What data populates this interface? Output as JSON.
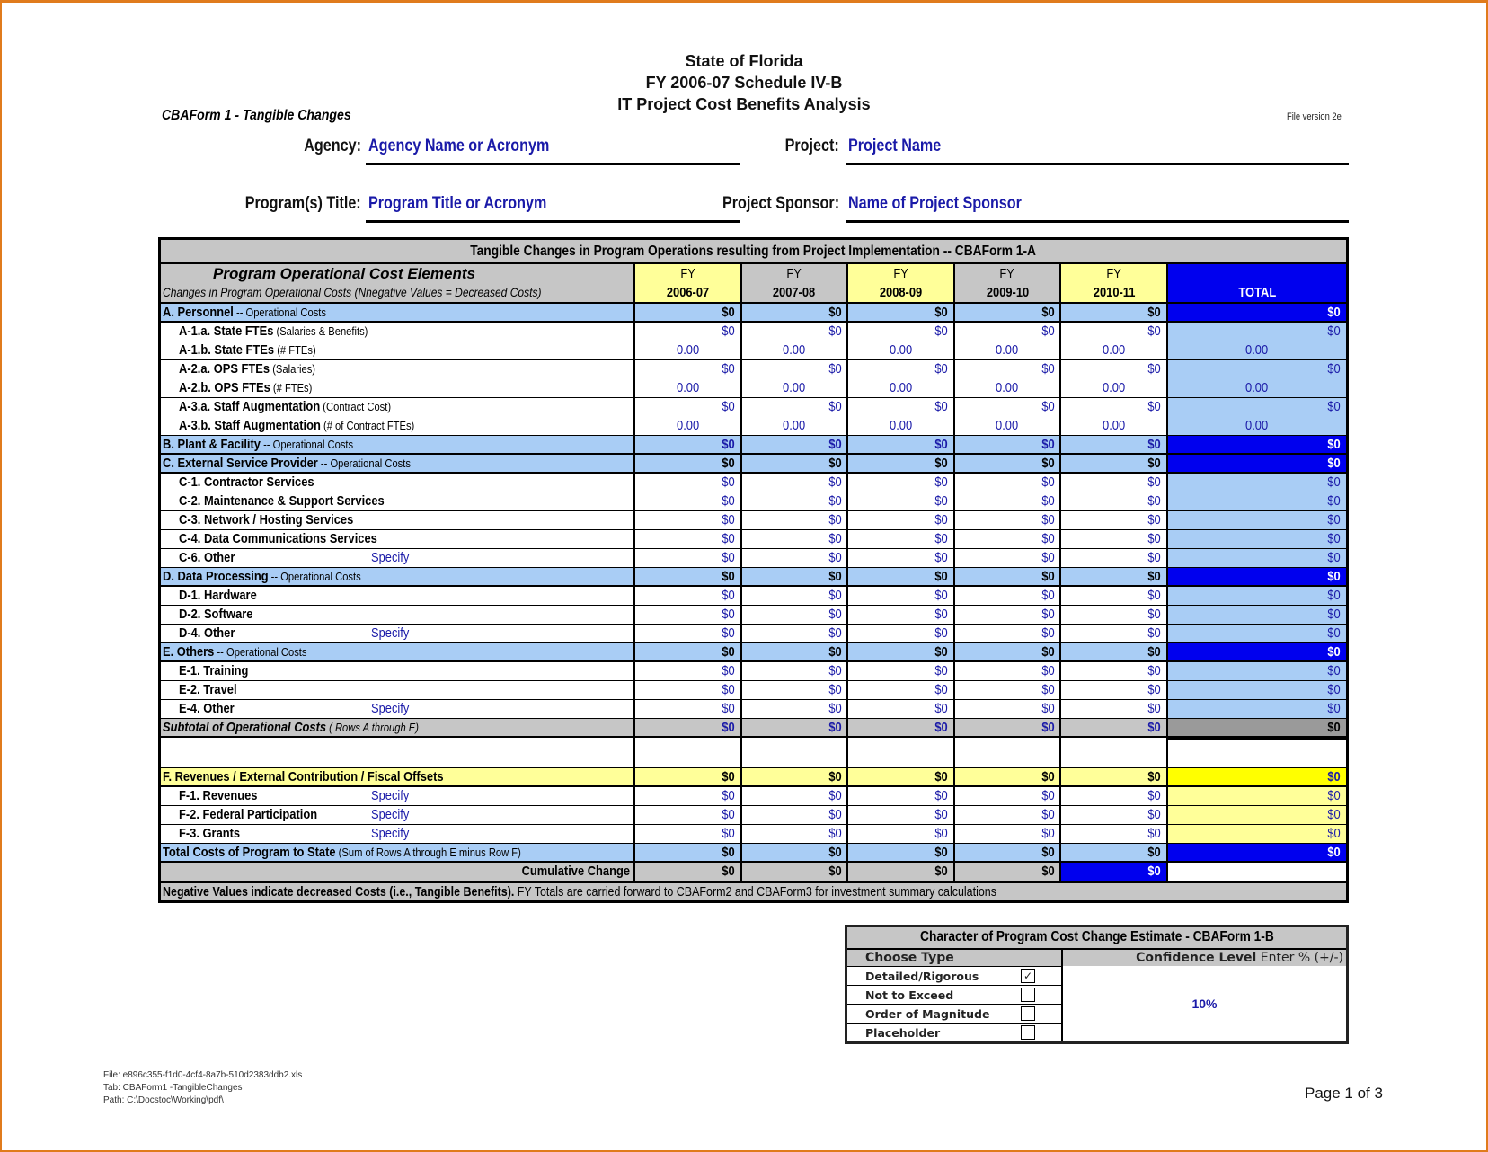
{
  "header": {
    "title_lines": [
      "State of Florida",
      "FY 2006-07 Schedule IV-B",
      "IT Project Cost Benefits Analysis"
    ],
    "form_name": "CBAForm 1 - Tangible Changes",
    "file_version": "File version 2e",
    "fields": {
      "agency_label": "Agency:",
      "agency_value": "Agency Name or Acronym",
      "project_label": "Project:",
      "project_value": "Project Name",
      "program_label": "Program(s) Title:",
      "program_value": "Program Title or Acronym",
      "sponsor_label": "Project Sponsor:",
      "sponsor_value": "Name of Project Sponsor"
    }
  },
  "table": {
    "title": "Tangible Changes in Program Operations resulting from Project  Implementation  -- CBAForm 1-A",
    "elements_header": "Program Operational Cost Elements",
    "elements_subheader": "Changes in Program Operational Costs (Nnegative Values = Decreased Costs)",
    "fy_prefix": "FY",
    "fiscal_years": [
      "2006-07",
      "2007-08",
      "2008-09",
      "2009-10",
      "2010-11"
    ],
    "total_label": "TOTAL",
    "rows": {
      "a": {
        "label": "A. Personnel",
        "suffix": " -- Operational Costs",
        "values": [
          "$0",
          "$0",
          "$0",
          "$0",
          "$0"
        ],
        "total": "$0"
      },
      "a1a": {
        "label": "A-1.a.  State FTEs",
        "suffix": " (Salaries & Benefits)",
        "values": [
          "$0",
          "$0",
          "$0",
          "$0",
          "$0"
        ],
        "total": "$0"
      },
      "a1b": {
        "label": "A-1.b.  State FTEs",
        "suffix": " (# FTEs)",
        "values": [
          "0.00",
          "0.00",
          "0.00",
          "0.00",
          "0.00"
        ],
        "total": "0.00"
      },
      "a2a": {
        "label": "A-2.a.  OPS FTEs",
        "suffix": " (Salaries)",
        "values": [
          "$0",
          "$0",
          "$0",
          "$0",
          "$0"
        ],
        "total": "$0"
      },
      "a2b": {
        "label": "A-2.b.  OPS FTEs",
        "suffix": " (# FTEs)",
        "values": [
          "0.00",
          "0.00",
          "0.00",
          "0.00",
          "0.00"
        ],
        "total": "0.00"
      },
      "a3a": {
        "label": "A-3.a.  Staff Augmentation",
        "suffix": " (Contract Cost)",
        "values": [
          "$0",
          "$0",
          "$0",
          "$0",
          "$0"
        ],
        "total": "$0"
      },
      "a3b": {
        "label": "A-3.b.  Staff Augmentation",
        "suffix": " (# of Contract FTEs)",
        "values": [
          "0.00",
          "0.00",
          "0.00",
          "0.00",
          "0.00"
        ],
        "total": "0.00"
      },
      "b": {
        "label": "B. Plant & Facility",
        "suffix": " -- Operational Costs",
        "values": [
          "$0",
          "$0",
          "$0",
          "$0",
          "$0"
        ],
        "total": "$0"
      },
      "c": {
        "label": "C. External Service Provider",
        "suffix": " -- Operational Costs",
        "values": [
          "$0",
          "$0",
          "$0",
          "$0",
          "$0"
        ],
        "total": "$0"
      },
      "c1": {
        "label": "C-1. Contractor Services",
        "values": [
          "$0",
          "$0",
          "$0",
          "$0",
          "$0"
        ],
        "total": "$0"
      },
      "c2": {
        "label": "C-2. Maintenance & Support Services",
        "values": [
          "$0",
          "$0",
          "$0",
          "$0",
          "$0"
        ],
        "total": "$0"
      },
      "c3": {
        "label": "C-3. Network / Hosting Services",
        "values": [
          "$0",
          "$0",
          "$0",
          "$0",
          "$0"
        ],
        "total": "$0"
      },
      "c4": {
        "label": "C-4. Data Communications Services",
        "values": [
          "$0",
          "$0",
          "$0",
          "$0",
          "$0"
        ],
        "total": "$0"
      },
      "c6": {
        "label": "C-6. Other",
        "specify": "Specify",
        "values": [
          "$0",
          "$0",
          "$0",
          "$0",
          "$0"
        ],
        "total": "$0"
      },
      "d": {
        "label": "D. Data Processing",
        "suffix": " -- Operational Costs",
        "values": [
          "$0",
          "$0",
          "$0",
          "$0",
          "$0"
        ],
        "total": "$0"
      },
      "d1": {
        "label": "D-1. Hardware",
        "values": [
          "$0",
          "$0",
          "$0",
          "$0",
          "$0"
        ],
        "total": "$0"
      },
      "d2": {
        "label": "D-2. Software",
        "values": [
          "$0",
          "$0",
          "$0",
          "$0",
          "$0"
        ],
        "total": "$0"
      },
      "d4": {
        "label": "D-4. Other",
        "specify": "Specify",
        "values": [
          "$0",
          "$0",
          "$0",
          "$0",
          "$0"
        ],
        "total": "$0"
      },
      "e": {
        "label": "E. Others",
        "suffix": " -- Operational Costs",
        "values": [
          "$0",
          "$0",
          "$0",
          "$0",
          "$0"
        ],
        "total": "$0"
      },
      "e1": {
        "label": "E-1. Training",
        "values": [
          "$0",
          "$0",
          "$0",
          "$0",
          "$0"
        ],
        "total": "$0"
      },
      "e2": {
        "label": "E-2. Travel",
        "values": [
          "$0",
          "$0",
          "$0",
          "$0",
          "$0"
        ],
        "total": "$0"
      },
      "e4": {
        "label": "E-4. Other",
        "specify": "Specify",
        "values": [
          "$0",
          "$0",
          "$0",
          "$0",
          "$0"
        ],
        "total": "$0"
      },
      "sub": {
        "label": "Subtotal of Operational Costs",
        "suffix": "  ( Rows A through E)",
        "values": [
          "$0",
          "$0",
          "$0",
          "$0",
          "$0"
        ],
        "total": "$0"
      },
      "f": {
        "label": "F.  Revenues / External Contribution / Fiscal Offsets",
        "values": [
          "$0",
          "$0",
          "$0",
          "$0",
          "$0"
        ],
        "total": "$0"
      },
      "f1": {
        "label": "F-1.  Revenues",
        "specify": "Specify",
        "values": [
          "$0",
          "$0",
          "$0",
          "$0",
          "$0"
        ],
        "total": "$0"
      },
      "f2": {
        "label": "F-2.  Federal Participation",
        "specify": "Specify",
        "values": [
          "$0",
          "$0",
          "$0",
          "$0",
          "$0"
        ],
        "total": "$0"
      },
      "f3": {
        "label": "F-3.  Grants",
        "specify": "Specify",
        "values": [
          "$0",
          "$0",
          "$0",
          "$0",
          "$0"
        ],
        "total": "$0"
      },
      "tot": {
        "label": "Total  Costs of Program to State",
        "suffix": " (Sum of Rows A through E minus Row F)",
        "values": [
          "$0",
          "$0",
          "$0",
          "$0",
          "$0"
        ],
        "total": "$0"
      },
      "cum": {
        "label": "Cumulative Change",
        "values": [
          "$0",
          "$0",
          "$0",
          "$0",
          "$0"
        ]
      }
    },
    "note_bold": "Negative Values indicate decreased Costs (i.e., Tangible Benefits).",
    "note_rest": "  FY Totals are carried forward to CBAForm2 and CBAForm3 for investment summary calculations"
  },
  "form1b": {
    "title": "Character of Program Cost Change Estimate - CBAForm 1-B",
    "choose_type": "Choose Type",
    "confidence_label": "Confidence Level",
    "confidence_hint": " Enter % (+/-)",
    "confidence_value": "10%",
    "options": [
      {
        "label": "Detailed/Rigorous",
        "checked": true,
        "mark": "✓"
      },
      {
        "label": "Not to Exceed",
        "checked": false,
        "mark": ""
      },
      {
        "label": "Order of Magnitude",
        "checked": false,
        "mark": ""
      },
      {
        "label": "Placeholder",
        "checked": false,
        "mark": ""
      }
    ]
  },
  "footer": {
    "file": "File:  e896c355-f1d0-4cf4-8a7b-510d2383ddb2.xls",
    "tab": "Tab:  CBAForm1 -TangibleChanges",
    "path": "Path:  C:\\Docstoc\\Working\\pdf\\",
    "page": "Page 1 of 3"
  }
}
